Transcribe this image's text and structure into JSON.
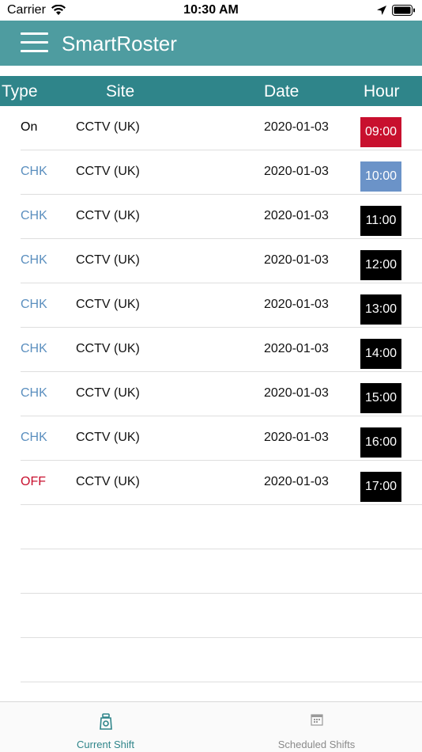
{
  "status_bar": {
    "carrier": "Carrier",
    "time": "10:30 AM"
  },
  "nav": {
    "title": "SmartRoster"
  },
  "table": {
    "headers": {
      "type": "Type",
      "site": "Site",
      "date": "Date",
      "hour": "Hour"
    },
    "rows": [
      {
        "type": "On",
        "type_color": "#000000",
        "site": "CCTV (UK)",
        "date": "2020-01-03",
        "hour": "09:00",
        "hour_bg": "#c8102e"
      },
      {
        "type": "CHK",
        "type_color": "#5b8fbf",
        "site": "CCTV (UK)",
        "date": "2020-01-03",
        "hour": "10:00",
        "hour_bg": "#6b93c8"
      },
      {
        "type": "CHK",
        "type_color": "#5b8fbf",
        "site": "CCTV (UK)",
        "date": "2020-01-03",
        "hour": "11:00",
        "hour_bg": "#000000"
      },
      {
        "type": "CHK",
        "type_color": "#5b8fbf",
        "site": "CCTV (UK)",
        "date": "2020-01-03",
        "hour": "12:00",
        "hour_bg": "#000000"
      },
      {
        "type": "CHK",
        "type_color": "#5b8fbf",
        "site": "CCTV (UK)",
        "date": "2020-01-03",
        "hour": "13:00",
        "hour_bg": "#000000"
      },
      {
        "type": "CHK",
        "type_color": "#5b8fbf",
        "site": "CCTV (UK)",
        "date": "2020-01-03",
        "hour": "14:00",
        "hour_bg": "#000000"
      },
      {
        "type": "CHK",
        "type_color": "#5b8fbf",
        "site": "CCTV (UK)",
        "date": "2020-01-03",
        "hour": "15:00",
        "hour_bg": "#000000"
      },
      {
        "type": "CHK",
        "type_color": "#5b8fbf",
        "site": "CCTV (UK)",
        "date": "2020-01-03",
        "hour": "16:00",
        "hour_bg": "#000000"
      },
      {
        "type": "OFF",
        "type_color": "#c8102e",
        "site": "CCTV (UK)",
        "date": "2020-01-03",
        "hour": "17:00",
        "hour_bg": "#000000"
      }
    ],
    "empty_rows": 4
  },
  "tab_bar": {
    "tabs": [
      {
        "label": "Current Shift",
        "icon": "guard-icon",
        "selected": true
      },
      {
        "label": "Scheduled Shifts",
        "icon": "calendar-icon",
        "selected": false
      }
    ]
  },
  "colors": {
    "nav_bg": "#4e9ca0",
    "header_bg": "#2f858a",
    "accent": "#2f858a"
  }
}
